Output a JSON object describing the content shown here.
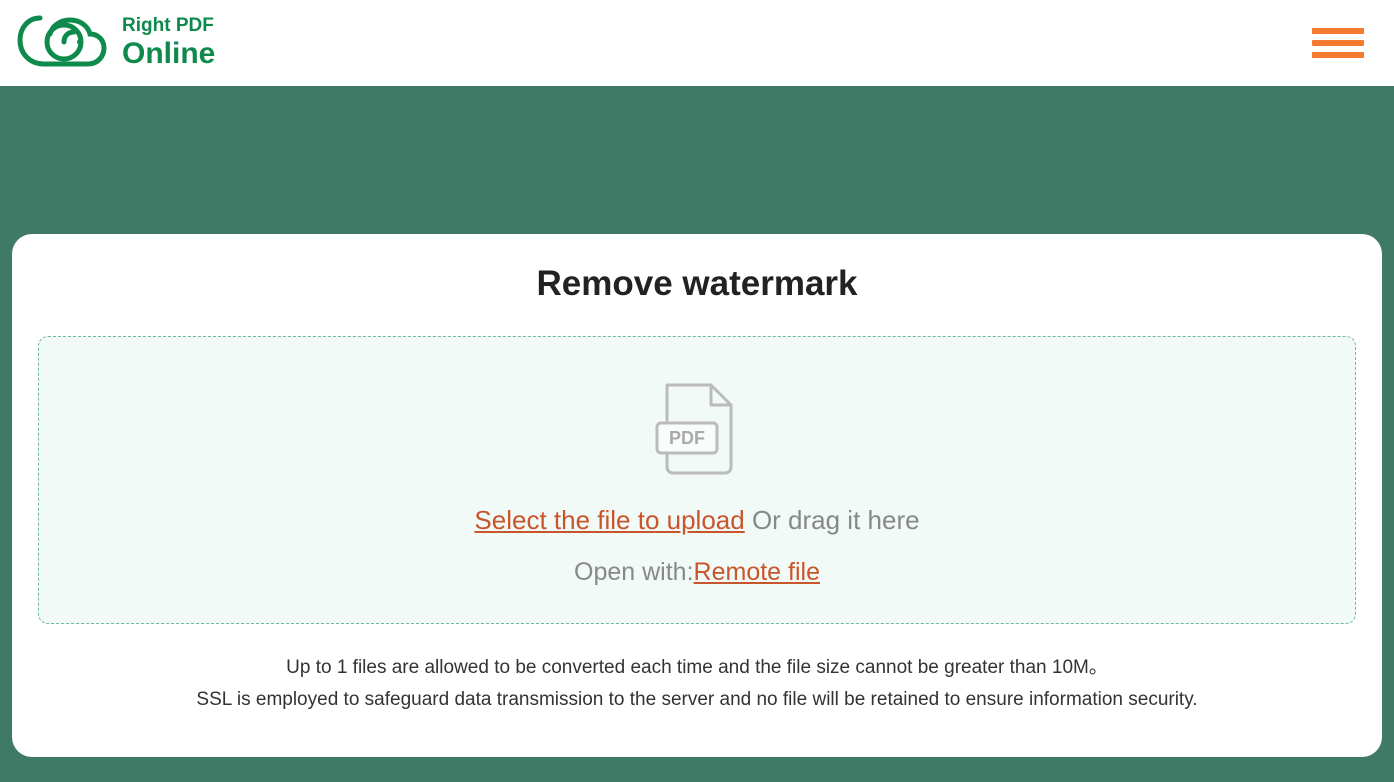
{
  "header": {
    "logo_top": "Right PDF",
    "logo_bottom": "Online"
  },
  "card": {
    "title": "Remove watermark",
    "select_file_label": "Select the file to upload",
    "drag_text": " Or drag it here",
    "open_with_label": "Open with:",
    "remote_file_label": "Remote file",
    "info_line1": "Up to 1 files are allowed to be converted each time and the file size cannot be greater than 10M。",
    "info_line2": "SSL is employed to safeguard data transmission to the server and no file will be retained to ensure information security."
  }
}
